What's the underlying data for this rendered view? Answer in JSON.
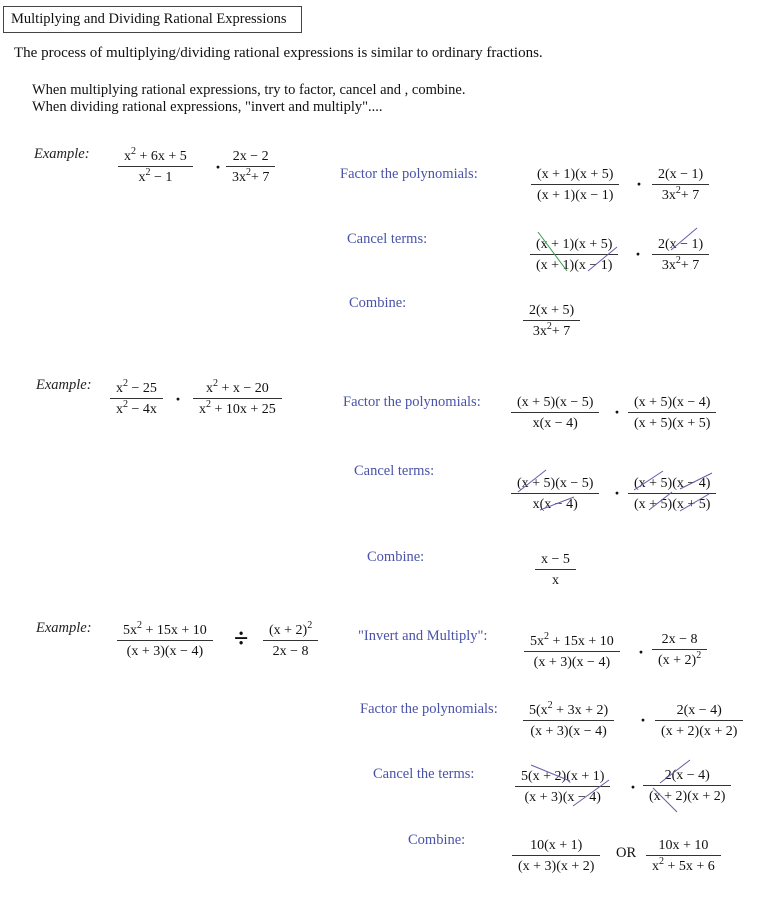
{
  "title": "Multiplying and Dividing Rational Expressions",
  "intro": "The process of multiplying/dividing rational expressions is similar to ordinary fractions.",
  "rules": [
    "When multiplying rational expressions, try to factor, cancel and , combine.",
    "When dividing rational expressions, \"invert and multiply\"...."
  ],
  "colors": {
    "step_label": "#4a52a8",
    "cancel_green": "#3a9a4a",
    "cancel_purple": "#6a5aa8"
  },
  "examples": [
    {
      "label": "Example:",
      "problem": {
        "operator": "multiply",
        "left": {
          "num": "x^2 + 6x + 5",
          "den": "x^2 − 1"
        },
        "right": {
          "num": "2x − 2",
          "den": "3x^2+ 7"
        }
      },
      "steps": [
        {
          "label": "Factor the polynomials:",
          "left": {
            "num": "(x + 1)(x + 5)",
            "den": "(x + 1)(x − 1)"
          },
          "right": {
            "num": "2(x − 1)",
            "den": "3x^2+ 7"
          }
        },
        {
          "label": "Cancel terms:",
          "left": {
            "num": "(x + 1)(x + 5)",
            "den": "(x + 1)(x − 1)"
          },
          "right": {
            "num": "2(x − 1)",
            "den": "3x^2+ 7"
          },
          "cancelled": [
            "(x + 1)",
            "(x − 1)"
          ]
        },
        {
          "label": "Combine:",
          "result": {
            "num": "2(x + 5)",
            "den": "3x^2+ 7"
          }
        }
      ]
    },
    {
      "label": "Example:",
      "problem": {
        "operator": "multiply",
        "left": {
          "num": "x^2 − 25",
          "den": "x^2 − 4x"
        },
        "right": {
          "num": "x^2 + x − 20",
          "den": "x^2 + 10x + 25"
        }
      },
      "steps": [
        {
          "label": "Factor the polynomials:",
          "left": {
            "num": "(x + 5)(x − 5)",
            "den": "x(x − 4)"
          },
          "right": {
            "num": "(x + 5)(x − 4)",
            "den": "(x + 5)(x + 5)"
          }
        },
        {
          "label": "Cancel terms:",
          "left": {
            "num": "(x + 5)(x − 5)",
            "den": "x(x − 4)"
          },
          "right": {
            "num": "(x + 5)(x − 4)",
            "den": "(x + 5)(x + 5)"
          },
          "cancelled": [
            "(x + 5)",
            "(x − 4)"
          ]
        },
        {
          "label": "Combine:",
          "result": {
            "num": "x − 5",
            "den": "x"
          }
        }
      ]
    },
    {
      "label": "Example:",
      "problem": {
        "operator": "divide",
        "left": {
          "num": "5x^2 + 15x + 10",
          "den": "(x + 3)(x − 4)"
        },
        "right": {
          "num": "(x + 2)^2",
          "den": "2x − 8"
        }
      },
      "steps": [
        {
          "label": "\"Invert and Multiply\":",
          "left": {
            "num": "5x^2 + 15x + 10",
            "den": "(x + 3)(x − 4)"
          },
          "right": {
            "num": "2x − 8",
            "den": "(x + 2)^2"
          }
        },
        {
          "label": "Factor the polynomials:",
          "left": {
            "num": "5(x^2 + 3x + 2)",
            "den": "(x + 3)(x − 4)"
          },
          "right": {
            "num": "2(x − 4)",
            "den": "(x + 2)(x + 2)"
          }
        },
        {
          "label": "Cancel the terms:",
          "left": {
            "num": "5(x + 2)(x + 1)",
            "den": "(x + 3)(x − 4)"
          },
          "right": {
            "num": "2(x − 4)",
            "den": "(x + 2)(x + 2)"
          },
          "cancelled": [
            "(x + 2)",
            "(x − 4)"
          ]
        },
        {
          "label": "Combine:",
          "result": {
            "num": "10(x + 1)",
            "den": "(x + 3)(x + 2)"
          },
          "or_label": "OR",
          "alt_result": {
            "num": "10x + 10",
            "den": "x^2 + 5x + 6"
          }
        }
      ]
    }
  ]
}
